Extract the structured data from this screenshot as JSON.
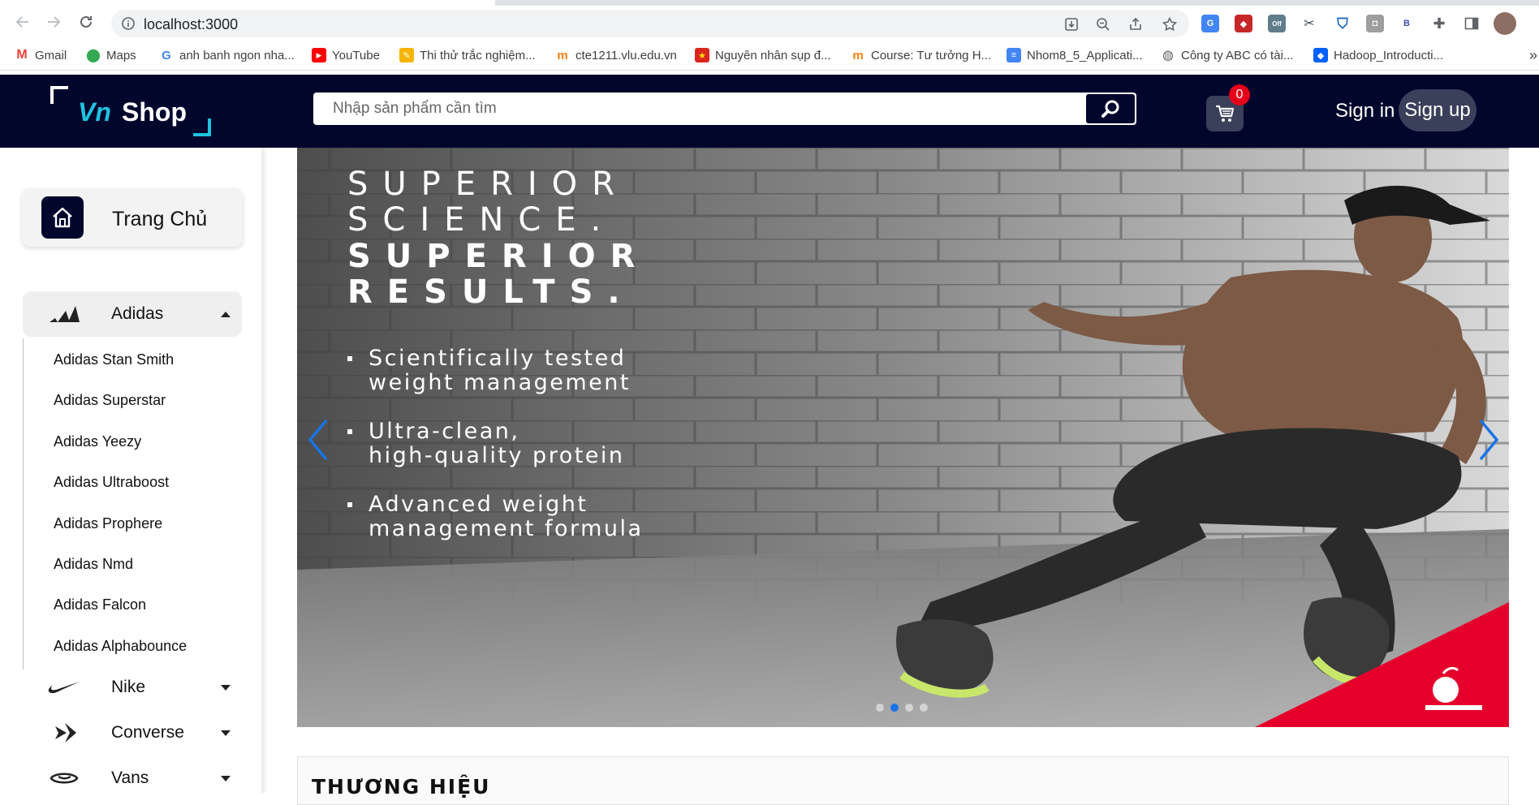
{
  "browser": {
    "url": "localhost:3000",
    "bookmarks": [
      {
        "label": "Gmail",
        "icon": "gmail-icon",
        "color": "#ea4335"
      },
      {
        "label": "Maps",
        "icon": "maps-icon",
        "color": "#34a853"
      },
      {
        "label": "anh banh ngon nha...",
        "icon": "google-icon",
        "color": "#4285f4"
      },
      {
        "label": "YouTube",
        "icon": "youtube-icon",
        "color": "#ff0000"
      },
      {
        "label": "Thi thử trắc nghiệm...",
        "icon": "quiz-icon",
        "color": "#f4b400"
      },
      {
        "label": "cte1211.vlu.edu.vn",
        "icon": "moodle-icon",
        "color": "#f98012"
      },
      {
        "label": "Nguyên nhân sụp đ...",
        "icon": "flag-icon",
        "color": "#da251d"
      },
      {
        "label": "Course: Tư tưởng H...",
        "icon": "moodle-icon",
        "color": "#f98012"
      },
      {
        "label": "Nhom8_5_Applicati...",
        "icon": "docs-icon",
        "color": "#4285f4"
      },
      {
        "label": "Công ty ABC có tài...",
        "icon": "globe-icon",
        "color": "#5f6368"
      },
      {
        "label": "Hadoop_Introducti...",
        "icon": "dropbox-icon",
        "color": "#0061ff"
      }
    ],
    "extensions": [
      {
        "icon": "translate-ext-icon",
        "color": "#4285f4"
      },
      {
        "icon": "red-ext-icon",
        "color": "#c62828"
      },
      {
        "icon": "off-ext-icon",
        "color": "#607d8b",
        "text": "Off"
      },
      {
        "icon": "tools-ext-icon",
        "color": "#37474f"
      },
      {
        "icon": "shield-ext-icon",
        "color": "#1565c0"
      },
      {
        "icon": "user-ext-icon",
        "color": "#9e9e9e"
      },
      {
        "icon": "b-ext-icon",
        "color": "#3f51b5",
        "text": "B"
      }
    ]
  },
  "header": {
    "logo_vn": "Vn",
    "logo_shop": "Shop",
    "search_placeholder": "Nhập sản phẩm cần tìm",
    "cart_count": "0",
    "signin_label": "Sign in",
    "signup_label": "Sign up"
  },
  "sidebar": {
    "home_label": "Trang Chủ",
    "brands": [
      {
        "label": "Adidas",
        "icon": "adidas-icon",
        "expanded": true
      },
      {
        "label": "Nike",
        "icon": "nike-icon",
        "expanded": false
      },
      {
        "label": "Converse",
        "icon": "converse-icon",
        "expanded": false
      },
      {
        "label": "Vans",
        "icon": "vans-icon",
        "expanded": false
      }
    ],
    "adidas_items": [
      "Adidas Stan Smith",
      "Adidas Superstar",
      "Adidas Yeezy",
      "Adidas Ultraboost",
      "Adidas Prophere",
      "Adidas Nmd",
      "Adidas Falcon",
      "Adidas Alphabounce"
    ]
  },
  "carousel": {
    "headline": [
      "SUPERIOR",
      "SCIENCE.",
      "SUPERIOR",
      "RESULTS."
    ],
    "bullets": [
      [
        "Scientifically tested",
        "weight management"
      ],
      [
        "Ultra-clean,",
        "high-quality protein"
      ],
      [
        "Advanced weight",
        "management formula"
      ]
    ],
    "slide_count": 4,
    "active_slide": 2
  },
  "brands_section": {
    "title": "THƯƠNG HIỆU"
  },
  "colors": {
    "header_bg": "#01062c",
    "accent": "#1ec3e0",
    "badge": "#e4001b",
    "ribbon": "#e4002b"
  }
}
